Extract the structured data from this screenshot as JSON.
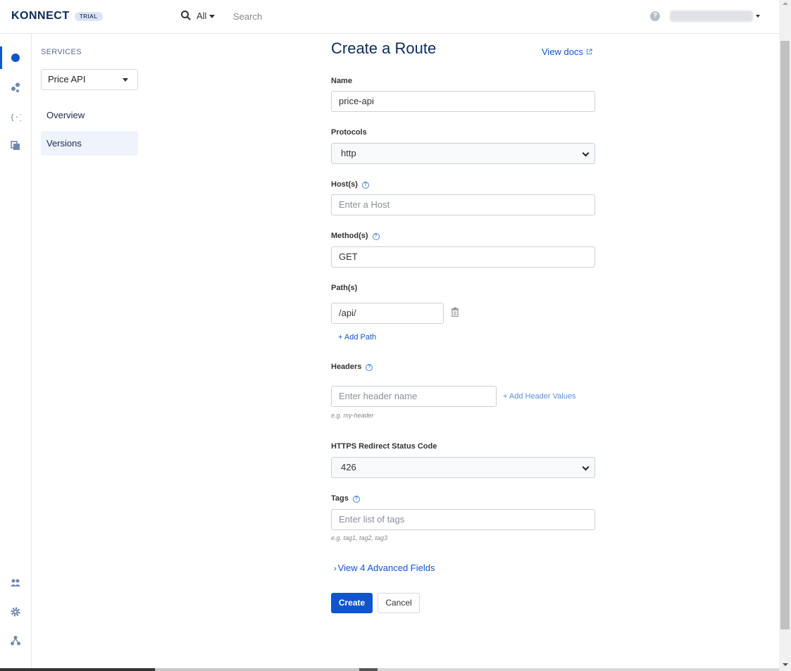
{
  "header": {
    "logo": "KONNECT",
    "trial_badge": "TRIAL",
    "search_scope": "All",
    "search_placeholder": "Search",
    "help_icon": "question-circle-icon",
    "account_caret_icon": "caret-down-icon"
  },
  "rail": {
    "items": [
      {
        "icon": "services-dot-icon",
        "active": true
      },
      {
        "icon": "runtime-nodes-icon"
      },
      {
        "icon": "api-spec-icon"
      },
      {
        "icon": "copy-icon"
      }
    ],
    "bottom_items": [
      {
        "icon": "team-icon"
      },
      {
        "icon": "settings-gear-icon"
      },
      {
        "icon": "org-hierarchy-icon"
      }
    ]
  },
  "subnav": {
    "heading": "SERVICES",
    "service_select": "Price API",
    "items": [
      {
        "label": "Overview",
        "active": false
      },
      {
        "label": "Versions",
        "active": true
      }
    ]
  },
  "form": {
    "title": "Create a Route",
    "view_docs": "View docs",
    "name": {
      "label": "Name",
      "value": "price-api"
    },
    "protocols": {
      "label": "Protocols",
      "value": "http"
    },
    "hosts": {
      "label": "Host(s)",
      "placeholder": "Enter a Host"
    },
    "methods": {
      "label": "Method(s)",
      "value": "GET"
    },
    "paths": {
      "label": "Path(s)",
      "value": "/api/",
      "add_label": "+ Add Path"
    },
    "headers": {
      "label": "Headers",
      "placeholder": "Enter header name",
      "add_values_label": "+ Add Header Values",
      "hint": "e.g. my-header"
    },
    "https_redirect": {
      "label": "HTTPS Redirect Status Code",
      "value": "426"
    },
    "tags": {
      "label": "Tags",
      "placeholder": "Enter list of tags",
      "hint": "e.g. tag1, tag2, tag3"
    },
    "advanced_link": "View 4 Advanced Fields",
    "create_label": "Create",
    "cancel_label": "Cancel"
  },
  "colors": {
    "accent": "#1155cb",
    "nav_active_bg": "#eef3fc",
    "title": "#0b2b5c"
  }
}
